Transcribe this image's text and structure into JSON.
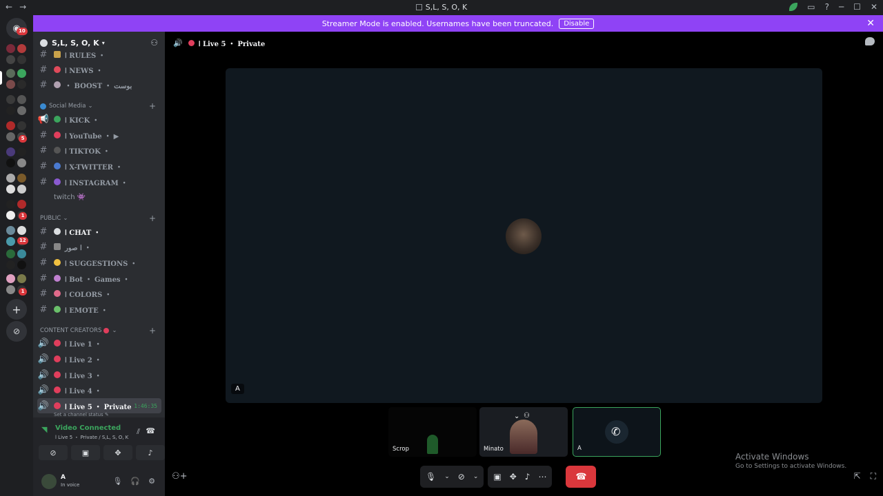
{
  "window": {
    "title": "S,L, S, O, K",
    "nav_back": "←",
    "nav_forward": "→",
    "minimize": "─",
    "maximize": "☐",
    "close": "✕"
  },
  "banner": {
    "text": "Streamer Mode is enabled. Usernames have been truncated.",
    "disable_label": "Disable",
    "close": "✕"
  },
  "servers": {
    "home_badge": "10",
    "badges": [
      "5",
      "1",
      "12",
      "1"
    ]
  },
  "guild": {
    "name": "S,L, S, O, K"
  },
  "channels_top": [
    {
      "label": "ا RULES ・"
    },
    {
      "label": "ا NEWS ・"
    },
    {
      "label": "・ BOOST ・ بوست"
    }
  ],
  "categories": {
    "social": "Social Media",
    "public": "PUBLIC",
    "creators": "CONTENT CREATORS"
  },
  "social_channels": [
    {
      "label": "ا KICK ・"
    },
    {
      "label": "ا YouTube ・ ▶"
    },
    {
      "label": "ا TIKTOK ・"
    },
    {
      "label": "ا X-TWITTER ・"
    },
    {
      "label": "ا INSTAGRAM ・"
    },
    {
      "label": "twitch 👾"
    }
  ],
  "public_channels": [
    {
      "label": "ا CHAT ・"
    },
    {
      "label": "ا صور ・"
    },
    {
      "label": "ا SUGGESTIONS ・"
    },
    {
      "label": "ا Bot ・ Games ・"
    },
    {
      "label": "ا COLORS ・"
    },
    {
      "label": "ا EMOTE ・"
    }
  ],
  "voice_channels": [
    {
      "label": "ا Live 1 ・"
    },
    {
      "label": "ا Live 2 ・"
    },
    {
      "label": "ا Live 3 ・"
    },
    {
      "label": "ا Live 4 ・"
    },
    {
      "label": "ا Live 5 ・ Private",
      "time": "1:46:35"
    }
  ],
  "channel_status_hint": "Set a channel status ✎",
  "voice": {
    "connected": "Video Connected",
    "location": "ا Live 5 ・ Private / S,L, S, O, K"
  },
  "user": {
    "name": "A",
    "status": "In voice"
  },
  "main": {
    "channel_title": "ا Live 5 ・ Private",
    "stage_label": "A",
    "tiles": [
      {
        "name": "Scrop"
      },
      {
        "name": "Minato"
      },
      {
        "name": "A"
      }
    ]
  },
  "activate": {
    "line1": "Activate Windows",
    "line2": "Go to Settings to activate Windows."
  }
}
